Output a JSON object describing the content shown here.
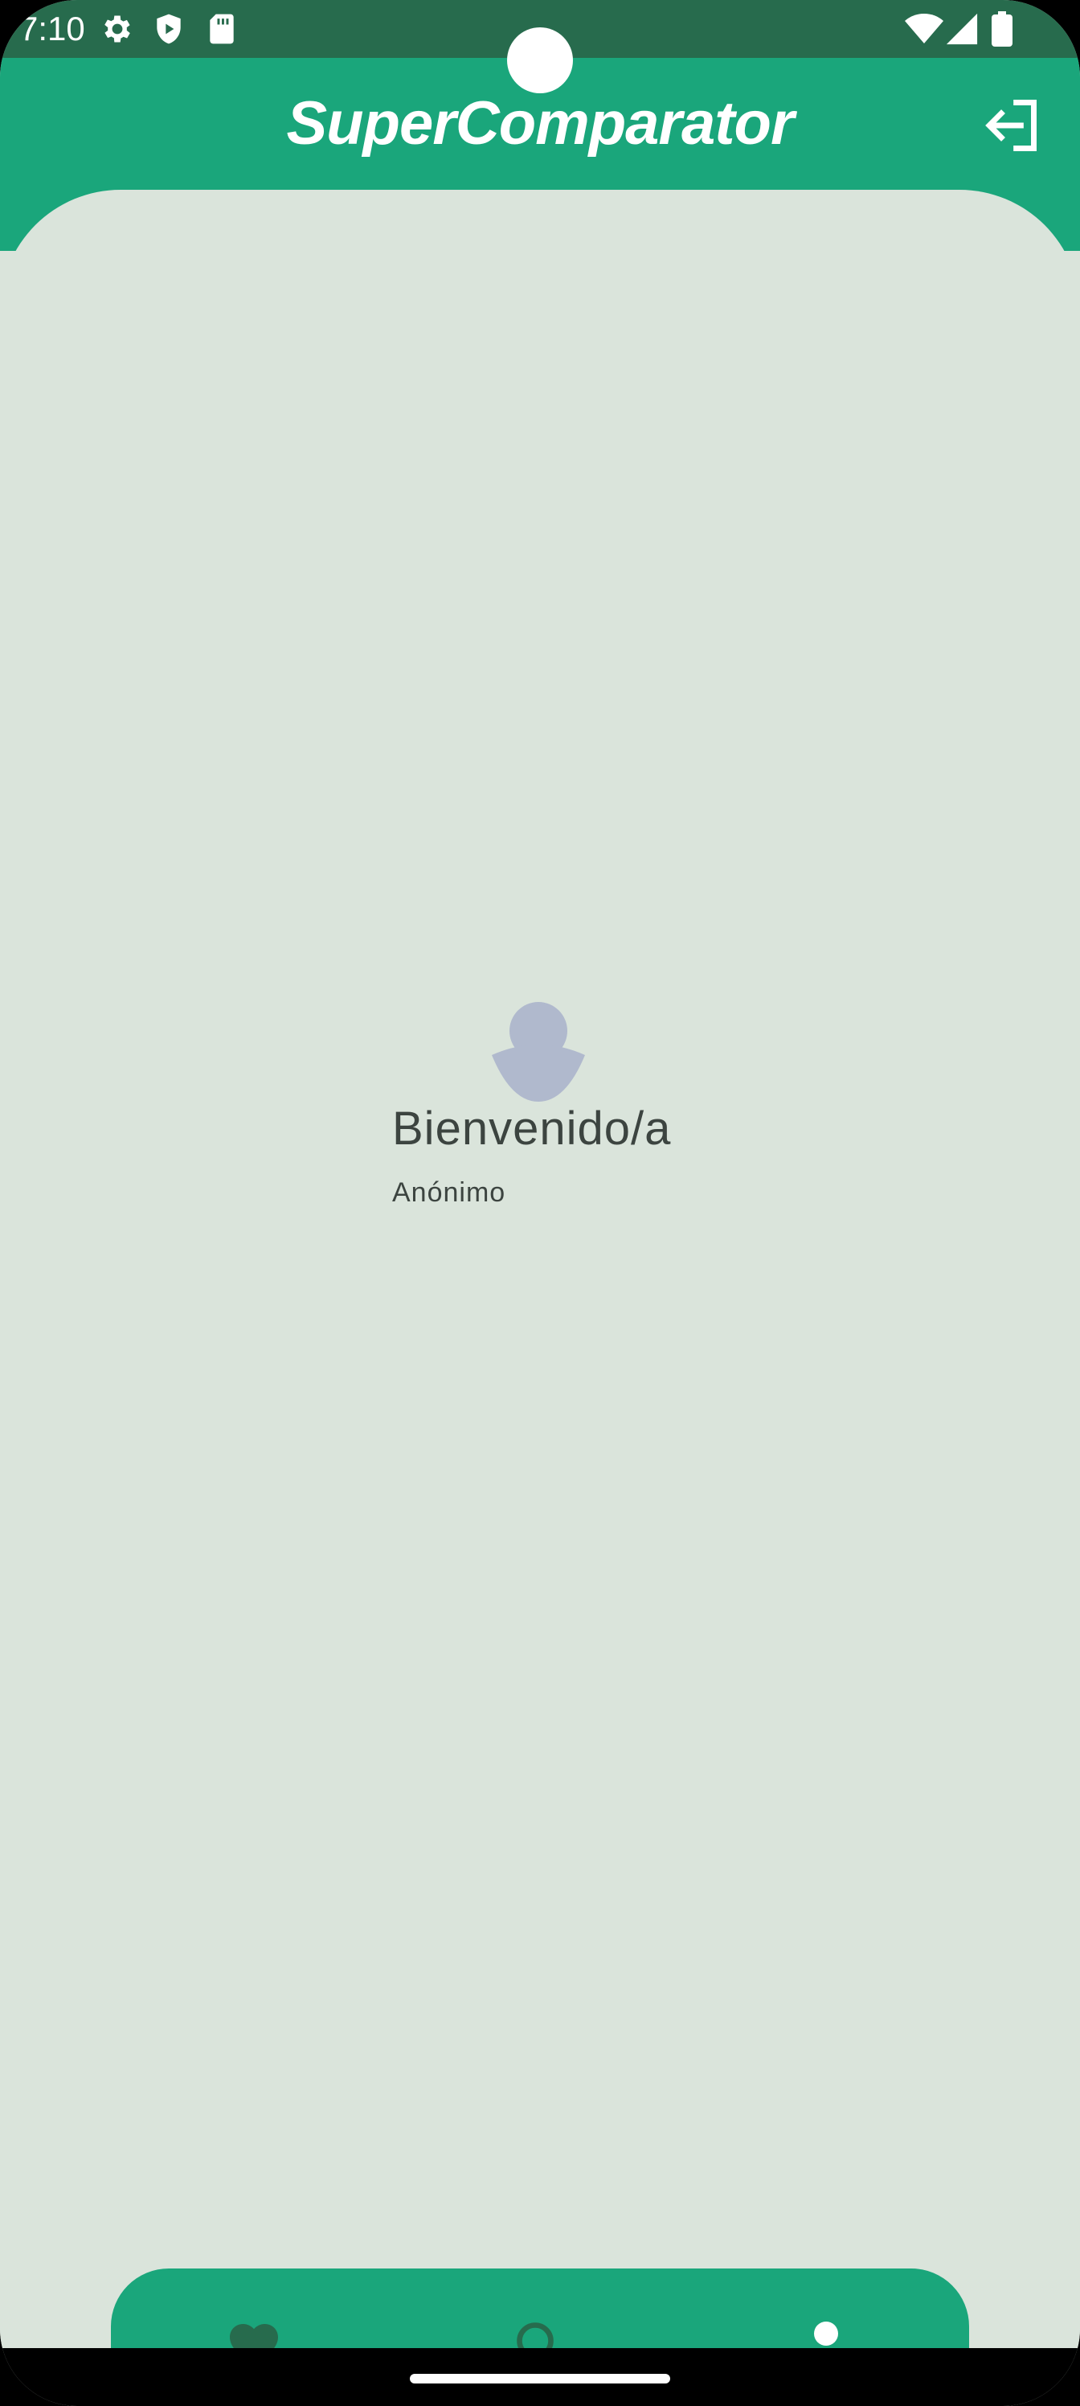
{
  "status_bar": {
    "time": "7:10",
    "icons": [
      "settings-icon",
      "shield-play-icon",
      "sd-card-icon",
      "wifi-icon",
      "signal-icon",
      "battery-icon"
    ]
  },
  "app_bar": {
    "title": "SuperComparator",
    "action_icon": "logout-icon"
  },
  "profile": {
    "avatar_icon": "person-avatar-icon",
    "welcome": "Bienvenido/a",
    "user_name": "Anónimo"
  },
  "bottom_nav": {
    "items": [
      {
        "icon": "heart-icon",
        "selected": false
      },
      {
        "icon": "search-icon",
        "selected": false
      },
      {
        "icon": "person-icon",
        "selected": true
      }
    ]
  },
  "colors": {
    "status_bar": "#276b4d",
    "primary": "#1aa67b",
    "background": "#dae4db",
    "nav_inactive_icon": "#276b4d",
    "nav_active_icon": "#ffffff",
    "avatar": "#b0b9cd",
    "text": "#3c4440"
  }
}
